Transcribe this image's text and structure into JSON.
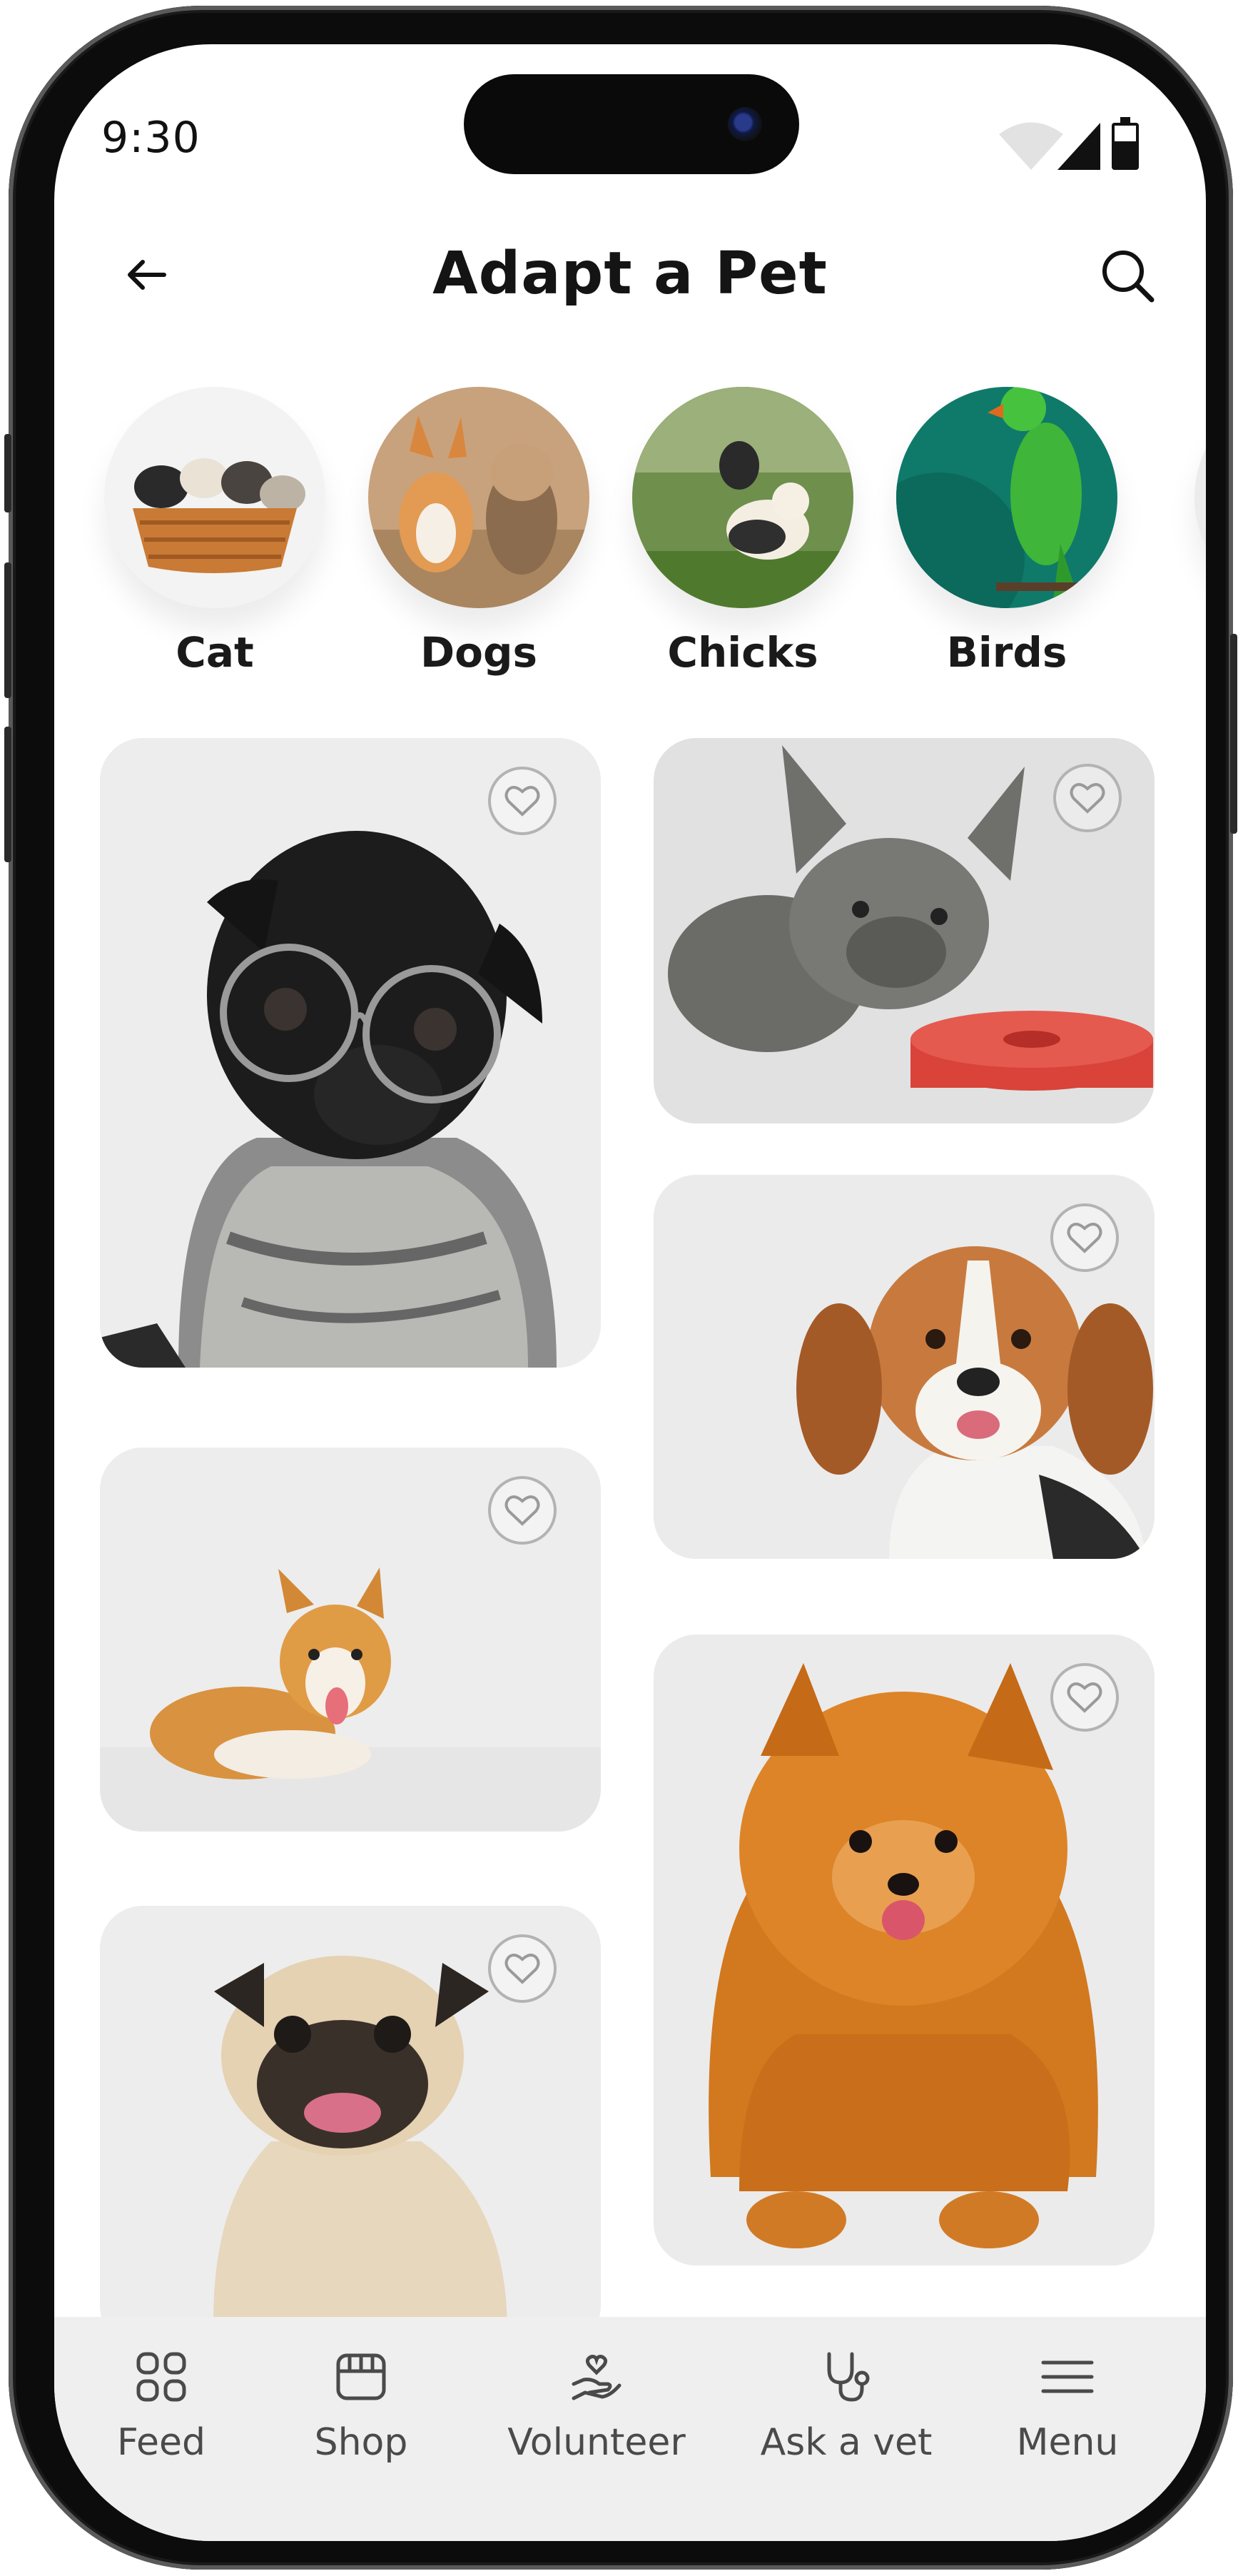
{
  "status_bar": {
    "time": "9:30"
  },
  "header": {
    "title": "Adapt a Pet"
  },
  "categories": [
    {
      "label": "Cat"
    },
    {
      "label": "Dogs"
    },
    {
      "label": "Chicks"
    },
    {
      "label": "Birds"
    }
  ],
  "pets": [
    {
      "name": "pug-with-glasses"
    },
    {
      "name": "french-bulldog-puppy"
    },
    {
      "name": "beagle"
    },
    {
      "name": "corgi"
    },
    {
      "name": "pomeranian"
    },
    {
      "name": "pug"
    }
  ],
  "nav": [
    {
      "label": "Feed",
      "icon": "grid-icon"
    },
    {
      "label": "Shop",
      "icon": "shop-icon"
    },
    {
      "label": "Volunteer",
      "icon": "hand-heart-icon"
    },
    {
      "label": "Ask a vet",
      "icon": "stethoscope-icon"
    },
    {
      "label": "Menu",
      "icon": "menu-icon"
    }
  ],
  "colors": {
    "card_bg": "#ebebeb",
    "nav_bg": "#efefef",
    "text": "#141414"
  }
}
